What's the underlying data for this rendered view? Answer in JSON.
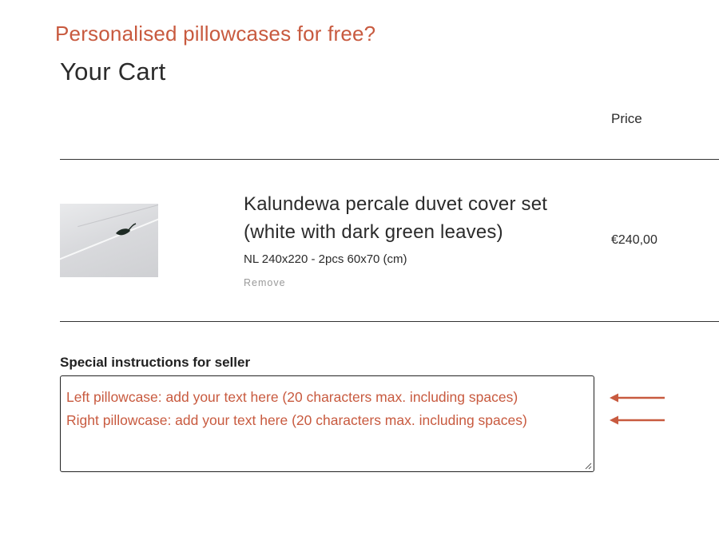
{
  "promo": {
    "text": "Personalised pillowcases for free?",
    "color": "#c85a3f"
  },
  "cart": {
    "title": "Your Cart",
    "columns": {
      "price": "Price"
    },
    "items": [
      {
        "name": "Kalundewa percale duvet cover set (white with dark green leaves)",
        "variant": "NL 240x220 - 2pcs 60x70 (cm)",
        "remove_label": "Remove",
        "price": "€240,00",
        "image_icon": "product-photo-duvet-cover"
      }
    ]
  },
  "instructions": {
    "label": "Special instructions for seller",
    "lines": [
      "Left pillowcase: add your text here (20 characters max. including spaces)",
      "Right pillowcase: add your text here (20 characters max. including spaces)"
    ],
    "text_color": "#c85a3f"
  },
  "annotations": {
    "arrow_icon": "left-arrow-icon",
    "arrow_color": "#c85a3f"
  }
}
